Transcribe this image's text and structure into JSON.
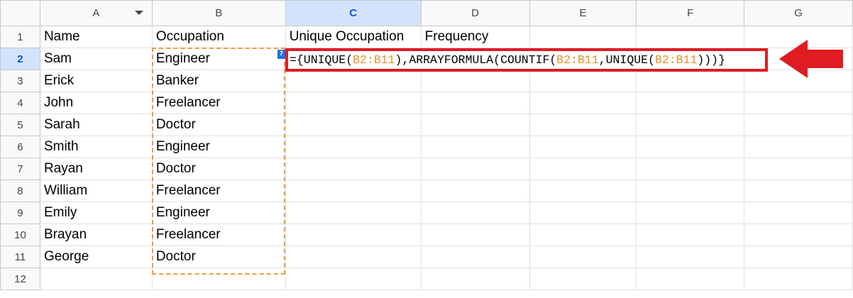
{
  "columns": [
    "A",
    "B",
    "C",
    "D",
    "E",
    "F",
    "G"
  ],
  "selected_column": "C",
  "selected_row": "2",
  "rows": [
    {
      "num": "1",
      "a": "Name",
      "b": "Occupation",
      "c": "Unique Occupation",
      "d": "Frequency"
    },
    {
      "num": "2",
      "a": "Sam",
      "b": "Engineer",
      "c": "",
      "d": ""
    },
    {
      "num": "3",
      "a": "Erick",
      "b": "Banker",
      "c": "",
      "d": ""
    },
    {
      "num": "4",
      "a": "John",
      "b": "Freelancer",
      "c": "",
      "d": ""
    },
    {
      "num": "5",
      "a": "Sarah",
      "b": "Doctor",
      "c": "",
      "d": ""
    },
    {
      "num": "6",
      "a": "Smith",
      "b": "Engineer",
      "c": "",
      "d": ""
    },
    {
      "num": "7",
      "a": "Rayan",
      "b": "Doctor",
      "c": "",
      "d": ""
    },
    {
      "num": "8",
      "a": "William",
      "b": "Freelancer",
      "c": "",
      "d": ""
    },
    {
      "num": "9",
      "a": "Emily",
      "b": "Engineer",
      "c": "",
      "d": ""
    },
    {
      "num": "10",
      "a": "Brayan",
      "b": "Freelancer",
      "c": "",
      "d": ""
    },
    {
      "num": "11",
      "a": "George",
      "b": "Doctor",
      "c": "",
      "d": ""
    },
    {
      "num": "12",
      "a": "",
      "b": "",
      "c": "",
      "d": ""
    }
  ],
  "formula": {
    "p1": "={UNIQUE(",
    "ref1": "B2:B11",
    "p2": "),ARRAYFORMULA(COUNTIF(",
    "ref2": "B2:B11",
    "p3": ",UNIQUE(",
    "ref3": "B2:B11",
    "p4": ")))}"
  },
  "help_chip": "?",
  "colors": {
    "highlight_border": "#e01b22",
    "arrow": "#e01b22",
    "range_reference": "#e8912e",
    "copy_range_border": "#f19a3c",
    "selected_header_bg": "#d3e3fd",
    "selected_header_text": "#0b57d0"
  },
  "icons": {
    "column_a_menu": "chevron-down-icon",
    "callout": "left-arrow-icon"
  }
}
